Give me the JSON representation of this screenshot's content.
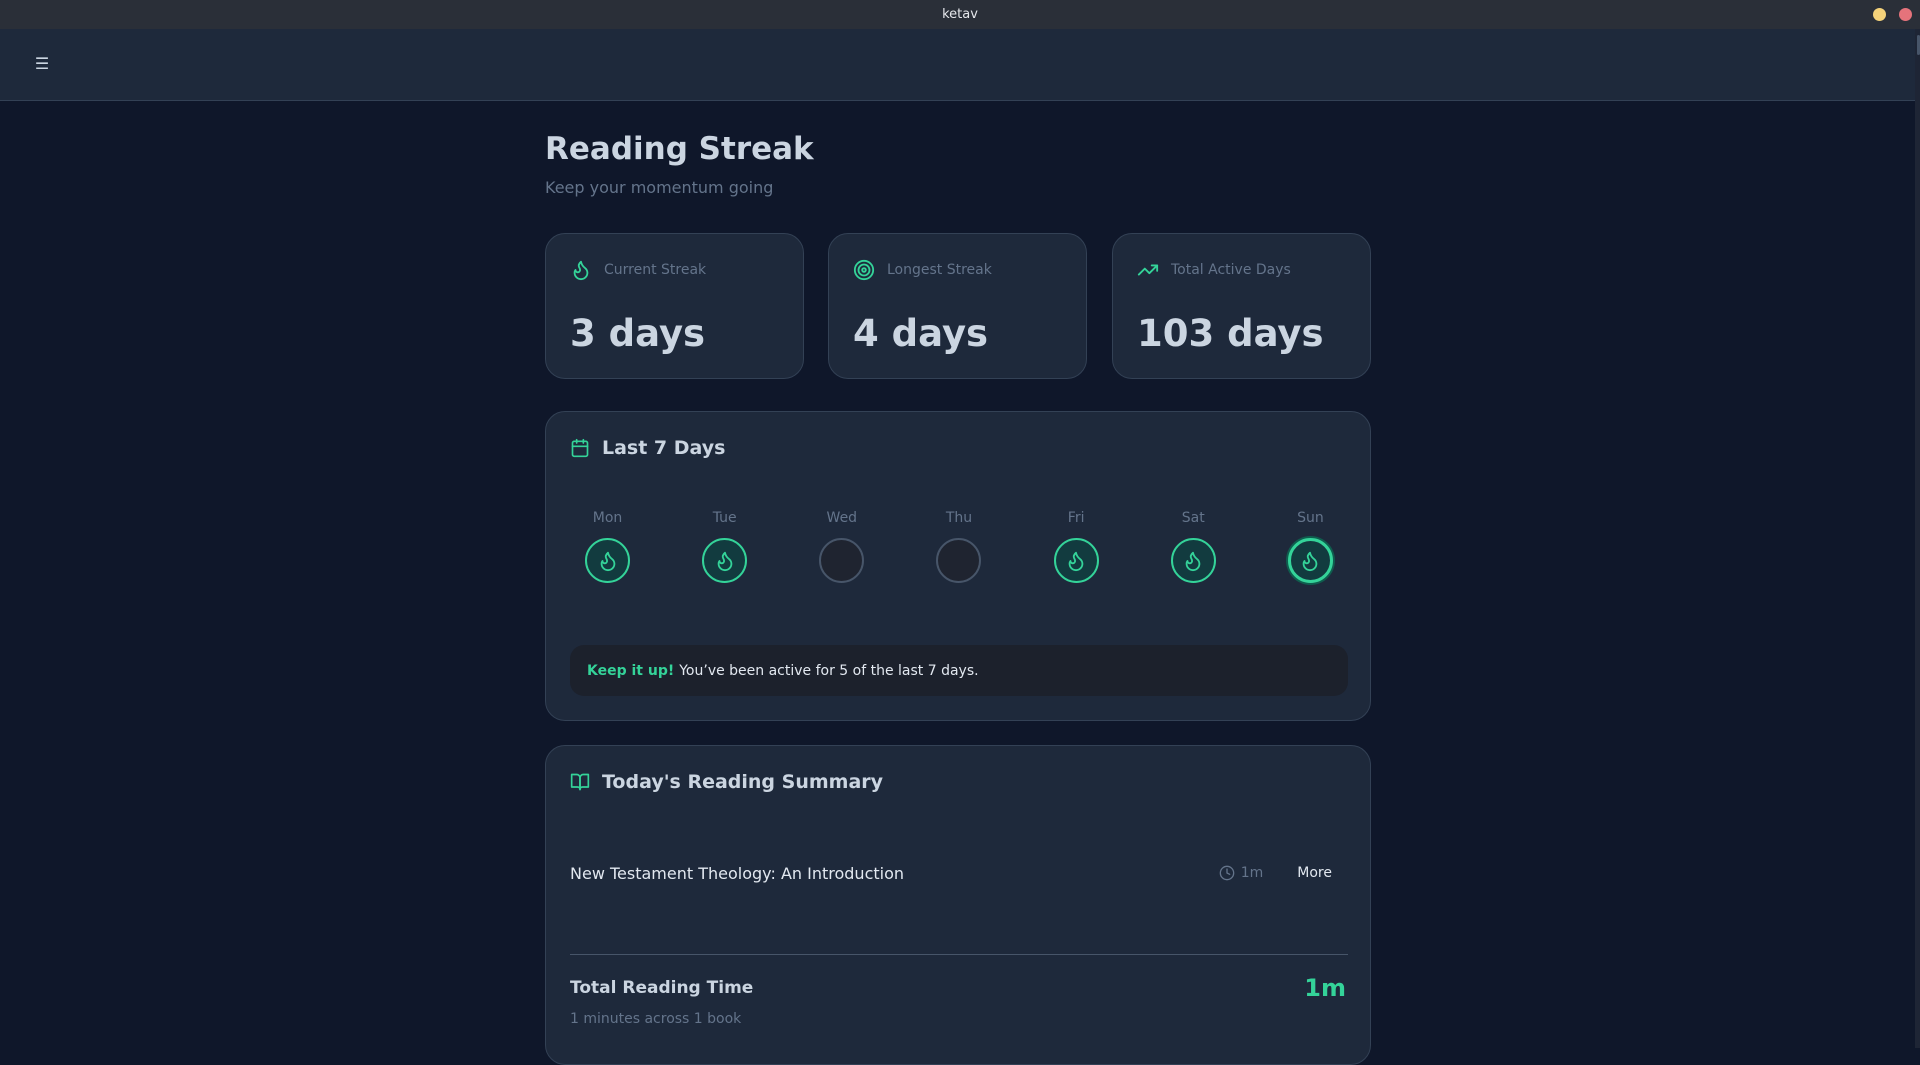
{
  "window": {
    "title": "ketav"
  },
  "header": {
    "menu_glyph": "☰"
  },
  "page": {
    "title": "Reading Streak",
    "subtitle": "Keep your momentum going"
  },
  "stats": [
    {
      "label": "Current Streak",
      "value": "3 days",
      "icon": "flame-icon"
    },
    {
      "label": "Longest Streak",
      "value": "4 days",
      "icon": "target-icon"
    },
    {
      "label": "Total Active Days",
      "value": "103 days",
      "icon": "trending-up-icon"
    }
  ],
  "week": {
    "title": "Last 7 Days",
    "days": [
      {
        "label": "Mon",
        "active": true,
        "today": false
      },
      {
        "label": "Tue",
        "active": true,
        "today": false
      },
      {
        "label": "Wed",
        "active": false,
        "today": false
      },
      {
        "label": "Thu",
        "active": false,
        "today": false
      },
      {
        "label": "Fri",
        "active": true,
        "today": false
      },
      {
        "label": "Sat",
        "active": true,
        "today": false
      },
      {
        "label": "Sun",
        "active": true,
        "today": true
      }
    ],
    "message_strong": "Keep it up!",
    "message_text": "You’ve been active for 5 of the last 7 days."
  },
  "summary": {
    "title": "Today's Reading Summary",
    "books": [
      {
        "title": "New Testament Theology: An Introduction",
        "time": "1m",
        "action": "More"
      }
    ],
    "total_label": "Total Reading Time",
    "total_value": "1m",
    "total_sub": "1 minutes across 1 book"
  },
  "colors": {
    "accent": "#34d399",
    "background": "#0f172a",
    "card": "#1e293b",
    "border": "#334155"
  }
}
